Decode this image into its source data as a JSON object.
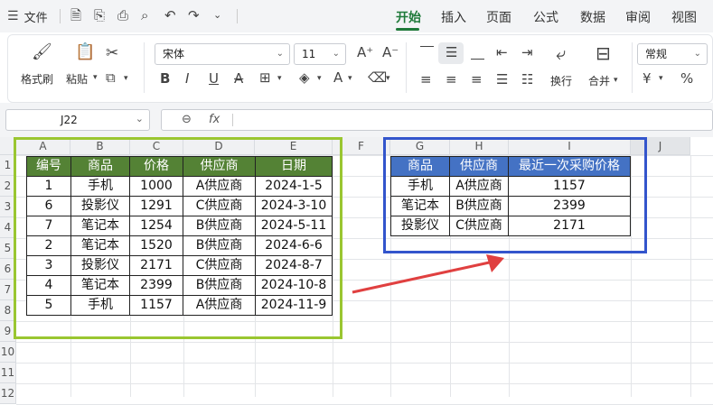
{
  "topbar": {
    "file_label": "文件",
    "tabs": [
      {
        "label": "开始",
        "active": true
      },
      {
        "label": "插入",
        "active": false
      },
      {
        "label": "页面",
        "active": false
      },
      {
        "label": "公式",
        "active": false
      },
      {
        "label": "数据",
        "active": false
      },
      {
        "label": "审阅",
        "active": false
      },
      {
        "label": "视图",
        "active": false
      }
    ]
  },
  "ribbon": {
    "format_painter": "格式刷",
    "paste": "粘贴",
    "font_name": "宋体",
    "font_size": "11",
    "wrap": "换行",
    "merge": "合并",
    "number_format": "常规",
    "currency_symbol": "¥",
    "percent_symbol": "%"
  },
  "formula_bar": {
    "name_box": "J22",
    "formula": ""
  },
  "grid": {
    "columns": [
      "A",
      "B",
      "C",
      "D",
      "E",
      "F",
      "G",
      "H",
      "I",
      "J"
    ],
    "rows": [
      "1",
      "2",
      "3",
      "4",
      "5",
      "6",
      "7",
      "8",
      "9",
      "10",
      "11",
      "12"
    ]
  },
  "table1": {
    "headers": [
      "编号",
      "商品",
      "价格",
      "供应商",
      "日期"
    ],
    "rows": [
      [
        "1",
        "手机",
        "1000",
        "A供应商",
        "2024-1-5"
      ],
      [
        "6",
        "投影仪",
        "1291",
        "C供应商",
        "2024-3-10"
      ],
      [
        "7",
        "笔记本",
        "1254",
        "B供应商",
        "2024-5-11"
      ],
      [
        "2",
        "笔记本",
        "1520",
        "B供应商",
        "2024-6-6"
      ],
      [
        "3",
        "投影仪",
        "2171",
        "C供应商",
        "2024-8-7"
      ],
      [
        "4",
        "笔记本",
        "2399",
        "B供应商",
        "2024-10-8"
      ],
      [
        "5",
        "手机",
        "1157",
        "A供应商",
        "2024-11-9"
      ]
    ]
  },
  "table2": {
    "headers": [
      "商品",
      "供应商",
      "最近一次采购价格"
    ],
    "rows": [
      [
        "手机",
        "A供应商",
        "1157"
      ],
      [
        "笔记本",
        "B供应商",
        "2399"
      ],
      [
        "投影仪",
        "C供应商",
        "2171"
      ]
    ]
  },
  "colors": {
    "accent_green": "#1f7a3a",
    "table1_header": "#548235",
    "table1_frame": "#9ac631",
    "table2_header": "#4472c4",
    "table2_frame": "#3355cc",
    "arrow": "#e04040"
  }
}
